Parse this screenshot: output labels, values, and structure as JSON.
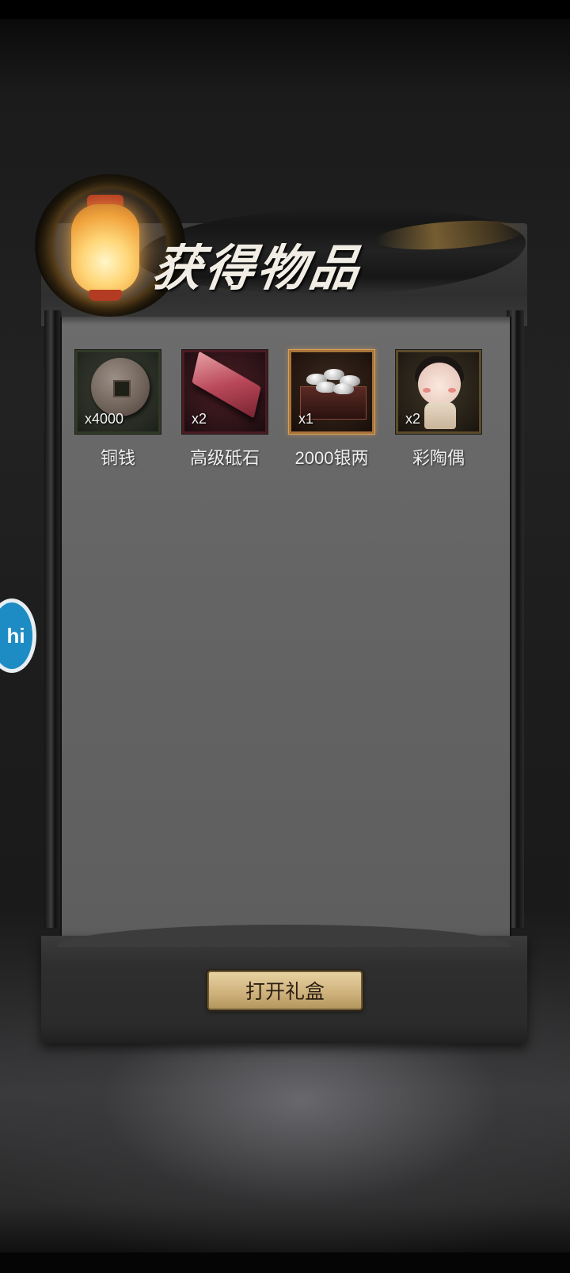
{
  "title": "获得物品",
  "items": [
    {
      "name": "铜钱",
      "qty": "x4000",
      "icon": "copper-coin-icon"
    },
    {
      "name": "高级砥石",
      "qty": "x2",
      "icon": "whetstone-icon"
    },
    {
      "name": "2000银两",
      "qty": "x1",
      "icon": "silver-chest-icon"
    },
    {
      "name": "彩陶偶",
      "qty": "x2",
      "icon": "ceramic-doll-icon"
    }
  ],
  "open_button_label": "打开礼盒",
  "floating_badge_label": "hi"
}
